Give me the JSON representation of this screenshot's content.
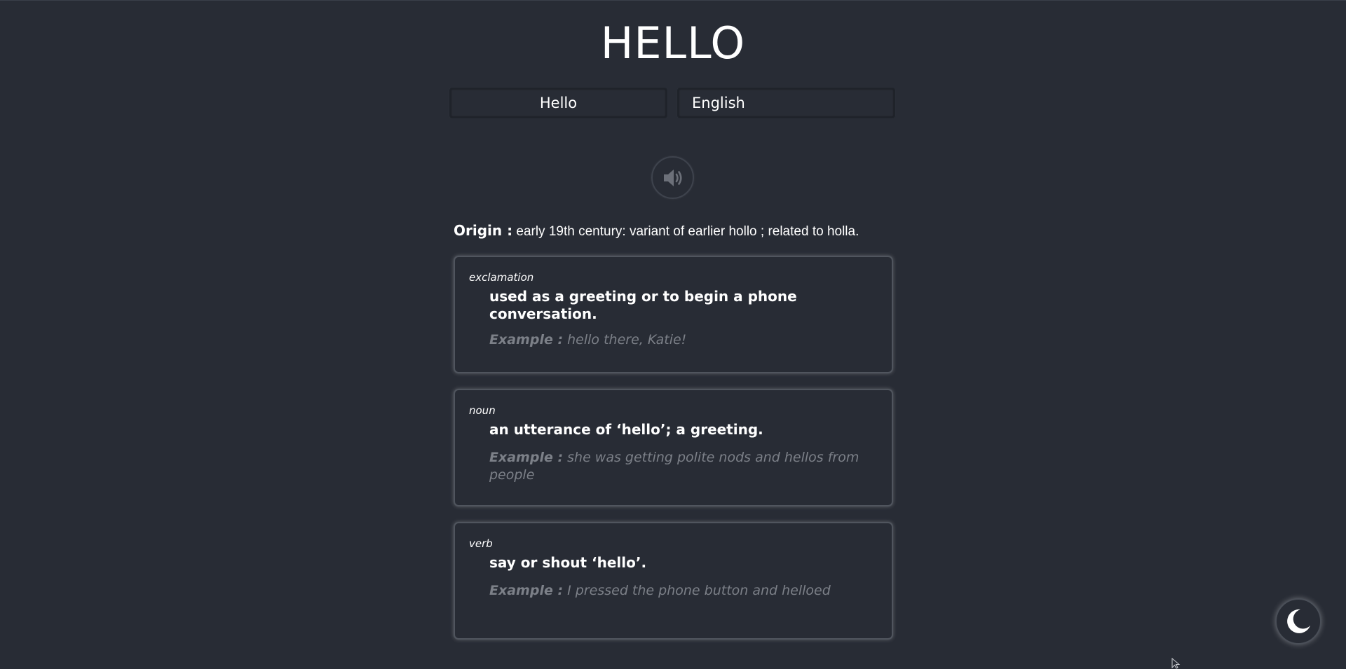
{
  "header": {
    "title": "HELLO"
  },
  "search": {
    "word_value": "Hello",
    "language_value": "English"
  },
  "pronunciation": {
    "icon": "speaker-icon"
  },
  "origin": {
    "label": "Origin :",
    "text": "early 19th century: variant of earlier hollo ; related to holla."
  },
  "definitions": [
    {
      "part_of_speech": "exclamation",
      "definition": "used as a greeting or to begin a phone conversation.",
      "example_label": "Example :",
      "example": "hello there, Katie!"
    },
    {
      "part_of_speech": "noun",
      "definition": "an utterance of ‘hello’; a greeting.",
      "example_label": "Example :",
      "example": "she was getting polite nods and hellos from people"
    },
    {
      "part_of_speech": "verb",
      "definition": "say or shout ‘hello’.",
      "example_label": "Example :",
      "example": "I pressed the phone button and helloed"
    }
  ],
  "theme_toggle": {
    "icon": "moon-icon"
  },
  "colors": {
    "background": "#282c35",
    "text": "#ffffff",
    "example_text": "#7c8088"
  }
}
